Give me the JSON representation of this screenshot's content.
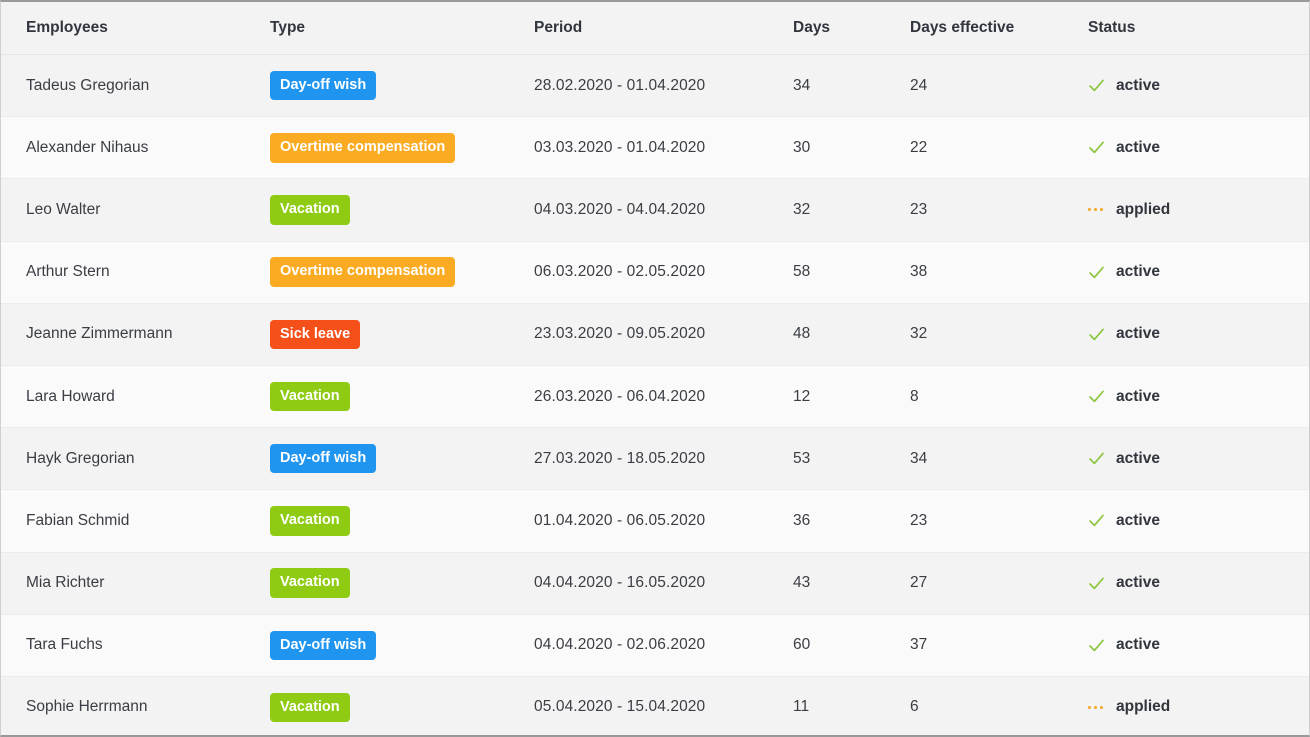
{
  "table": {
    "columns": [
      {
        "key": "employee",
        "label": "Employees"
      },
      {
        "key": "type",
        "label": "Type"
      },
      {
        "key": "period",
        "label": "Period"
      },
      {
        "key": "days",
        "label": "Days"
      },
      {
        "key": "days_effective",
        "label": "Days effective"
      },
      {
        "key": "status",
        "label": "Status"
      }
    ],
    "type_colors": {
      "Day-off wish": "#1f95f0",
      "Overtime compensation": "#fbab22",
      "Vacation": "#8fcb13",
      "Sick leave": "#f6501a"
    },
    "status_colors": {
      "active": "#8cc63f",
      "applied": "#f5a623"
    },
    "rows": [
      {
        "employee": "Tadeus Gregorian",
        "type": "Day-off wish",
        "type_class": "badge-dayoff",
        "period": "28.02.2020 - 01.04.2020",
        "days": "34",
        "days_effective": "24",
        "status": "active",
        "status_icon": "check-icon"
      },
      {
        "employee": "Alexander Nihaus",
        "type": "Overtime compensation",
        "type_class": "badge-overtime",
        "period": "03.03.2020 - 01.04.2020",
        "days": "30",
        "days_effective": "22",
        "status": "active",
        "status_icon": "check-icon"
      },
      {
        "employee": "Leo Walter",
        "type": "Vacation",
        "type_class": "badge-vacation",
        "period": "04.03.2020 - 04.04.2020",
        "days": "32",
        "days_effective": "23",
        "status": "applied",
        "status_icon": "ellipsis-icon"
      },
      {
        "employee": "Arthur Stern",
        "type": "Overtime compensation",
        "type_class": "badge-overtime",
        "period": "06.03.2020 - 02.05.2020",
        "days": "58",
        "days_effective": "38",
        "status": "active",
        "status_icon": "check-icon"
      },
      {
        "employee": "Jeanne Zimmermann",
        "type": "Sick leave",
        "type_class": "badge-sick",
        "period": "23.03.2020 - 09.05.2020",
        "days": "48",
        "days_effective": "32",
        "status": "active",
        "status_icon": "check-icon"
      },
      {
        "employee": "Lara Howard",
        "type": "Vacation",
        "type_class": "badge-vacation",
        "period": "26.03.2020 - 06.04.2020",
        "days": "12",
        "days_effective": "8",
        "status": "active",
        "status_icon": "check-icon"
      },
      {
        "employee": "Hayk Gregorian",
        "type": "Day-off wish",
        "type_class": "badge-dayoff",
        "period": "27.03.2020 - 18.05.2020",
        "days": "53",
        "days_effective": "34",
        "status": "active",
        "status_icon": "check-icon"
      },
      {
        "employee": "Fabian Schmid",
        "type": "Vacation",
        "type_class": "badge-vacation",
        "period": "01.04.2020 - 06.05.2020",
        "days": "36",
        "days_effective": "23",
        "status": "active",
        "status_icon": "check-icon"
      },
      {
        "employee": "Mia Richter",
        "type": "Vacation",
        "type_class": "badge-vacation",
        "period": "04.04.2020 - 16.05.2020",
        "days": "43",
        "days_effective": "27",
        "status": "active",
        "status_icon": "check-icon"
      },
      {
        "employee": "Tara Fuchs",
        "type": "Day-off wish",
        "type_class": "badge-dayoff",
        "period": "04.04.2020 - 02.06.2020",
        "days": "60",
        "days_effective": "37",
        "status": "active",
        "status_icon": "check-icon"
      },
      {
        "employee": "Sophie Herrmann",
        "type": "Vacation",
        "type_class": "badge-vacation",
        "period": "05.04.2020 - 15.04.2020",
        "days": "11",
        "days_effective": "6",
        "status": "applied",
        "status_icon": "ellipsis-icon"
      }
    ]
  }
}
